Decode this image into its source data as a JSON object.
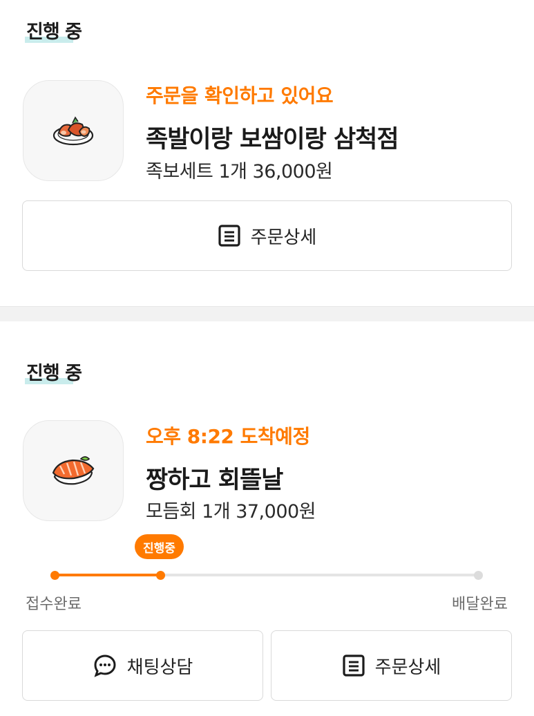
{
  "orders": [
    {
      "section_title": "진행 중",
      "status": "주문을 확인하고 있어요",
      "store_name": "족발이랑 보쌈이랑 삼척점",
      "items": "족보세트 1개 36,000원",
      "thumbnail_icon": "jokbal-icon",
      "buttons": {
        "detail_label": "주문상세"
      }
    },
    {
      "section_title": "진행 중",
      "status": "오후 8:22 도착예정",
      "store_name": "짱하고 회뜰날",
      "items": "모듬회 1개 37,000원",
      "thumbnail_icon": "sushi-icon",
      "progress": {
        "badge": "진행중",
        "fraction": 0.25,
        "start_label": "접수완료",
        "end_label": "배달완료"
      },
      "buttons": {
        "chat_label": "채팅상담",
        "detail_label": "주문상세"
      }
    }
  ],
  "colors": {
    "accent": "#ff7a00",
    "highlight": "#c9ecec",
    "track": "#e4e4e4",
    "divider": "#f2f2f2"
  }
}
